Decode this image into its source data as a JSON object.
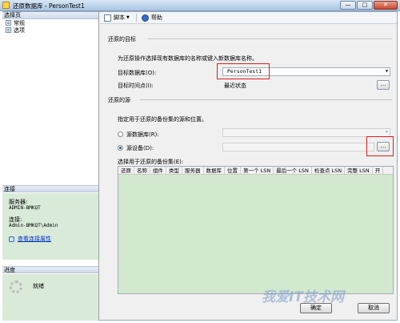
{
  "window": {
    "title": "还原数据库 - PersonTest1",
    "minimize": "—",
    "maximize": "□",
    "close": "✕"
  },
  "sidebar": {
    "select_page_header": "选择页",
    "pages": [
      {
        "label": "常规",
        "icon": "page-icon"
      },
      {
        "label": "选项",
        "icon": "page-icon"
      }
    ],
    "connection_header": "连接",
    "server_label": "服务器:",
    "server_value": "ADMIN-BMKQT",
    "conn_label": "连接:",
    "conn_value": "Admin-BMKQT\\Admin",
    "view_conn_props": "查看连接属性",
    "progress_header": "进度",
    "progress_status": "就绪"
  },
  "toolbar": {
    "script_label": "脚本",
    "help_label": "帮助"
  },
  "restore_target": {
    "section_title": "还原的目标",
    "description": "为还原操作选择现有数据库的名称或键入新数据库名称。",
    "target_db_label": "目标数据库(O):",
    "target_db_value": "PersonTest1",
    "target_time_label": "目标时间点(I):",
    "target_time_value": "最近状态"
  },
  "restore_source": {
    "section_title": "还原的源",
    "description": "指定用于还原的备份集的源和位置。",
    "from_db_label": "源数据库(R):",
    "from_device_label": "源设备(D):",
    "selected_source": "device",
    "backup_sets_label": "选择用于还原的备份集(E):",
    "columns": [
      "还原",
      "名称",
      "组件",
      "类型",
      "服务器",
      "数据库",
      "位置",
      "第一个 LSN",
      "最后一个 LSN",
      "检查点 LSN",
      "完整 LSN",
      "开"
    ]
  },
  "buttons": {
    "browse_dots": "...",
    "ok": "确定",
    "cancel": "取消"
  },
  "watermark": "我爱IT技术网",
  "colors": {
    "highlight_red": "#e21b1b",
    "panel_green": "#d2e9d0"
  }
}
